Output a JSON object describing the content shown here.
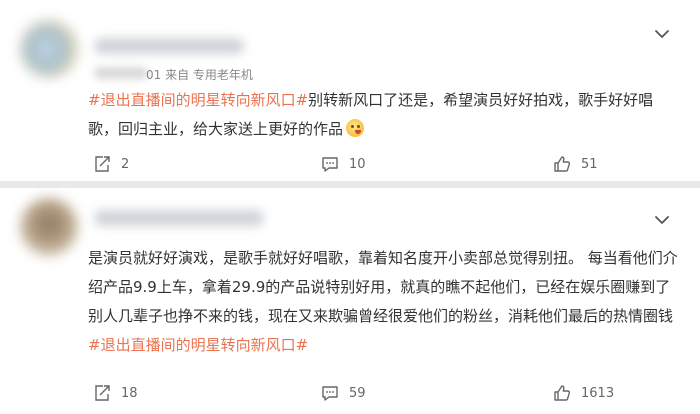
{
  "comments": [
    {
      "meta": "01  来自 专用老年机",
      "hashtag": "#退出直播间的明星转向新风口#",
      "text_after_tag": "别转新风口了还是，希望演员好好拍戏，歌手好好唱歌，回归主业，给大家送上更好的作品",
      "emoji_icon": "savoring-face-emoji-icon",
      "reposts": "2",
      "comments": "10",
      "likes": "51"
    },
    {
      "text": "是演员就好好演戏，是歌手就好好唱歌，靠着知名度开小卖部总觉得别扭。 每当看他们介绍产品9.9上车，拿着29.9的产品说特别好用，就真的瞧不起他们，已经在娱乐圈赚到了别人几辈子也挣不来的钱，现在又来欺骗曾经很爱他们的粉丝，消耗他们最后的热情圈钱",
      "hashtag": "#退出直播间的明星转向新风口#",
      "reposts": "18",
      "comments": "59",
      "likes": "1613"
    }
  ],
  "colors": {
    "hashtag": "#eb7350",
    "page_bg": "#e9e9e9",
    "card_bg": "#ffffff"
  },
  "icons": [
    "chevron-down-icon",
    "repost-icon",
    "comment-icon",
    "like-icon"
  ]
}
